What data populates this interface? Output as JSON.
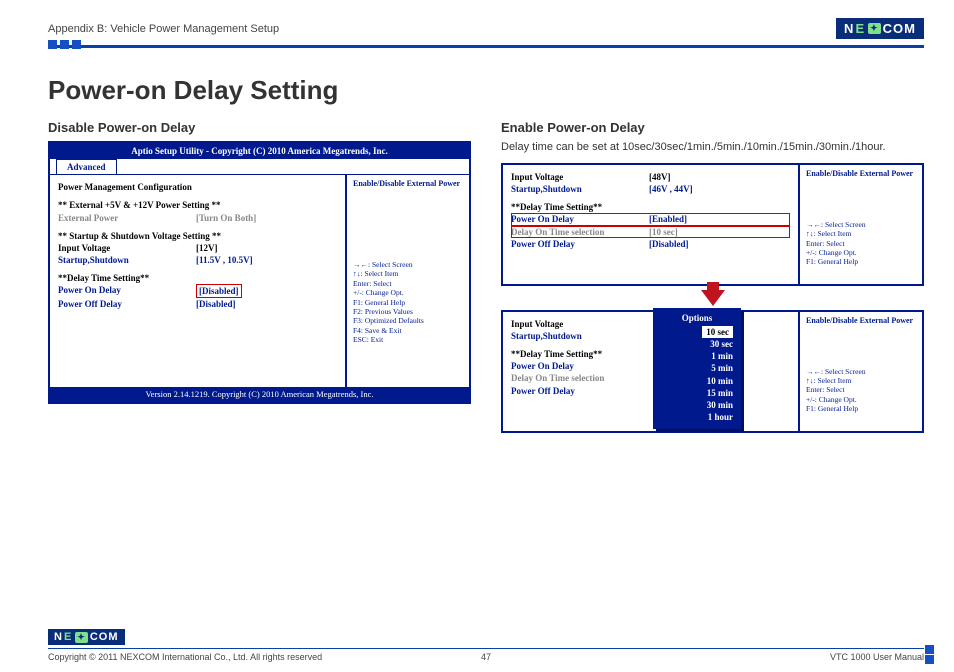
{
  "header": {
    "appendix": "Appendix B: Vehicle Power Management Setup",
    "brand": "NEXCOM"
  },
  "title": "Power-on Delay Setting",
  "left": {
    "heading": "Disable Power-on Delay",
    "bios_title": "Aptio Setup Utility - Copyright (C) 2010 America Megatrends, Inc.",
    "tab": "Advanced",
    "section1": "Power Management Configuration",
    "ext_hdr": "** External +5V & +12V Power Setting **",
    "ext_pwr_label": "External Power",
    "ext_pwr_val": "[Turn On Both]",
    "sv_hdr": "** Startup & Shutdown Voltage Setting **",
    "iv_label": "Input Voltage",
    "iv_val": "[12V]",
    "ss_label": "Startup,Shutdown",
    "ss_val": "[11.5V , 10.5V]",
    "dt_hdr": "**Delay Time Setting**",
    "pon_label": "Power On Delay",
    "pon_val": "[Disabled]",
    "poff_label": "Power Off Delay",
    "poff_val": "[Disabled]",
    "help": "Enable/Disable External Power",
    "keys": "→←: Select Screen\n↑↓: Select Item\nEnter: Select\n+/-: Change Opt.\nF1: General Help\nF2: Previous Values\nF3: Optimized Defaults\nF4: Save & Exit\nESC: Exit",
    "foot": "Version 2.14.1219. Copyright (C) 2010 American Megatrends, Inc."
  },
  "right": {
    "heading": "Enable Power-on Delay",
    "desc": "Delay time can be set at 10sec/30sec/1min./5min./10min./15min./30min./1hour.",
    "panel1": {
      "iv_label": "Input Voltage",
      "iv_val": "[48V]",
      "ss_label": "Startup,Shutdown",
      "ss_val": "[46V , 44V]",
      "dt_hdr": "**Delay Time Setting**",
      "pon_label": "Power On Delay",
      "pon_val": "[Enabled]",
      "dot_label": "Delay On Time selection",
      "dot_val": "[10 sec]",
      "poff_label": "Power Off Delay",
      "poff_val": "[Disabled]",
      "help": "Enable/Disable External Power",
      "keys": "→←: Select Screen\n↑↓: Select Item\nEnter: Select\n+/-: Change Opt.\nF1: General Help"
    },
    "panel2": {
      "iv_label": "Input Voltage",
      "ss_label": "Startup,Shutdown",
      "dt_hdr": "**Delay Time Setting**",
      "pon_label": "Power On Delay",
      "dot_label": "Delay On Time selection",
      "poff_label": "Power Off Delay",
      "help": "Enable/Disable External Power",
      "keys": "→←: Select Screen\n↑↓: Select Item\nEnter: Select\n+/-: Change Opt.\nF1: General Help",
      "options_title": "Options",
      "options": [
        "10 sec",
        "30 sec",
        "1 min",
        "5 min",
        "10 min",
        "15 min",
        "30 min",
        "1 hour"
      ]
    }
  },
  "footer": {
    "copyright": "Copyright © 2011 NEXCOM International Co., Ltd. All rights reserved",
    "page": "47",
    "manual": "VTC 1000 User Manual"
  }
}
